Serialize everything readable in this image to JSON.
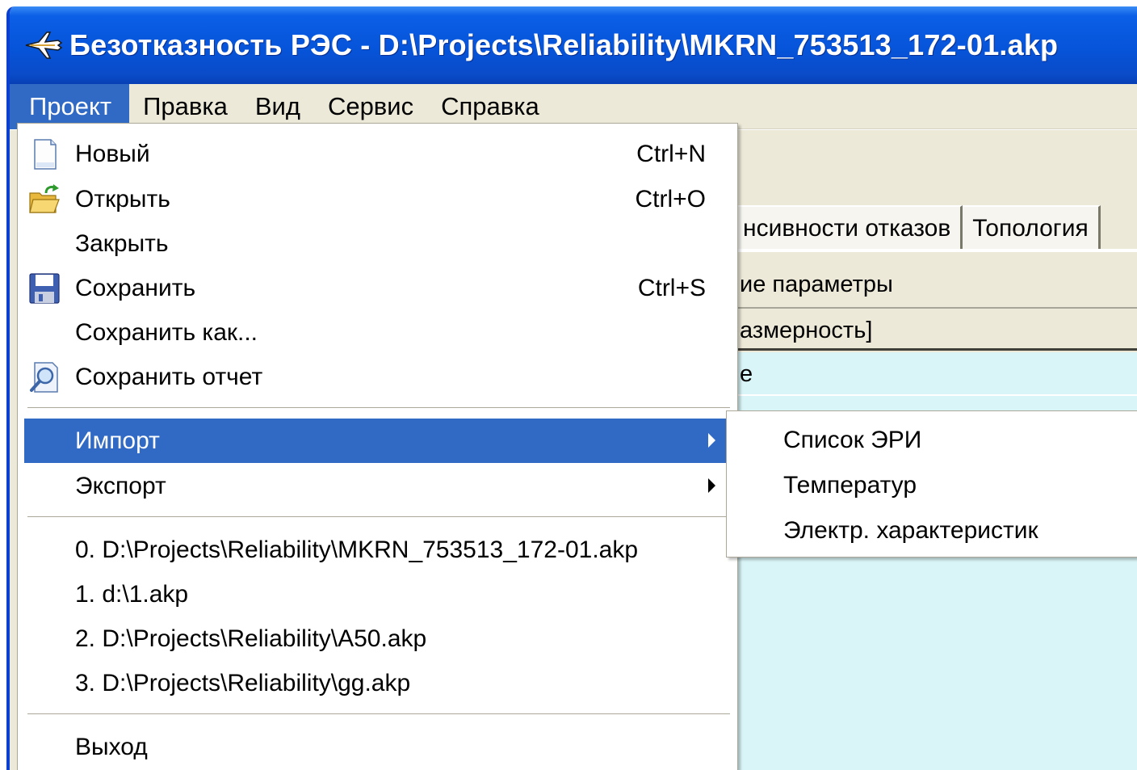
{
  "window": {
    "title": "Безотказность РЭС - D:\\Projects\\Reliability\\MKRN_753513_172-01.akp",
    "app_icon": "airplane-icon"
  },
  "menubar": {
    "items": [
      "Проект",
      "Правка",
      "Вид",
      "Сервис",
      "Справка"
    ],
    "active": "Проект"
  },
  "background": {
    "tabs": [
      "нсивности отказов",
      "Топология"
    ],
    "group_header": "ие параметры",
    "column_header": "азмерность]",
    "row_text": "е"
  },
  "dropdown": {
    "file_items": [
      {
        "label": "Новый",
        "shortcut": "Ctrl+N",
        "icon": "new-document-icon"
      },
      {
        "label": "Открыть",
        "shortcut": "Ctrl+O",
        "icon": "open-folder-icon"
      },
      {
        "label": "Закрыть",
        "shortcut": "",
        "icon": ""
      },
      {
        "label": "Сохранить",
        "shortcut": "Ctrl+S",
        "icon": "floppy-disk-icon"
      },
      {
        "label": "Сохранить как...",
        "shortcut": "",
        "icon": ""
      },
      {
        "label": "Сохранить отчет",
        "shortcut": "",
        "icon": "report-preview-icon"
      }
    ],
    "import_label": "Импорт",
    "export_label": "Экспорт",
    "recent_files": [
      "0. D:\\Projects\\Reliability\\MKRN_753513_172-01.akp",
      "1. d:\\1.akp",
      "2. D:\\Projects\\Reliability\\A50.akp",
      "3. D:\\Projects\\Reliability\\gg.akp"
    ],
    "exit_label": "Выход"
  },
  "submenu_import": {
    "items": [
      "Список ЭРИ",
      "Температур",
      "Электр. характеристик"
    ]
  },
  "colors": {
    "titlebar": "#0654d9",
    "menu_highlight": "#316ac5",
    "chrome": "#ece9d8",
    "grid_background": "#d9f5f7"
  }
}
